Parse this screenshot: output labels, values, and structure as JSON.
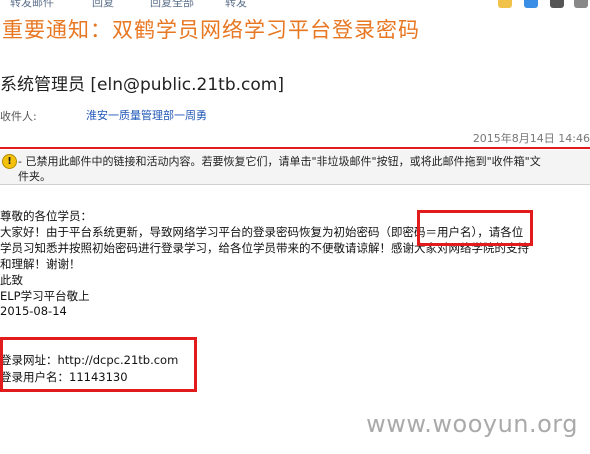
{
  "toolbar": {
    "items": [
      "转发邮件",
      "回复",
      "回复全部",
      "转发"
    ]
  },
  "email": {
    "subject": "重要通知：双鹤学员网络学习平台登录密码",
    "sender": "系统管理员 [eln@public.21tb.com]",
    "to_label": "收件人:",
    "to_value": "淮安一质量管理部一周勇",
    "date": "2015年8月14日 14:46"
  },
  "infobar": {
    "icon": "warning-shield-icon",
    "line1": "- 已禁用此邮件中的链接和活动内容。若要恢复它们，请单击\"非垃圾邮件\"按钮，或将此邮件拖到\"收件箱\"文",
    "line2": "件夹。"
  },
  "body": {
    "greeting": "尊敬的各位学员：",
    "p1": "大家好！由于平台系统更新，导致网络学习平台的登录密码恢复为初始密码（即密码＝用户名），请各位",
    "p2": "学员习知悉并按照初始密码进行登录学习，给各位学员带来的不便敬请谅解！感谢大家对网络学院的支持",
    "p3": "和理解！谢谢！",
    "sign1": "此致",
    "sign2": "ELP学习平台敬上",
    "sign_date": "2015-08-14",
    "url_line": "登录网址：http://dcpc.21tb.com",
    "user_line": "登录用户名：11143130"
  },
  "watermark": "www.wooyun.org",
  "colors": {
    "subject": "#e87722",
    "highlight": "#e21c1c",
    "link": "#2158b8"
  }
}
